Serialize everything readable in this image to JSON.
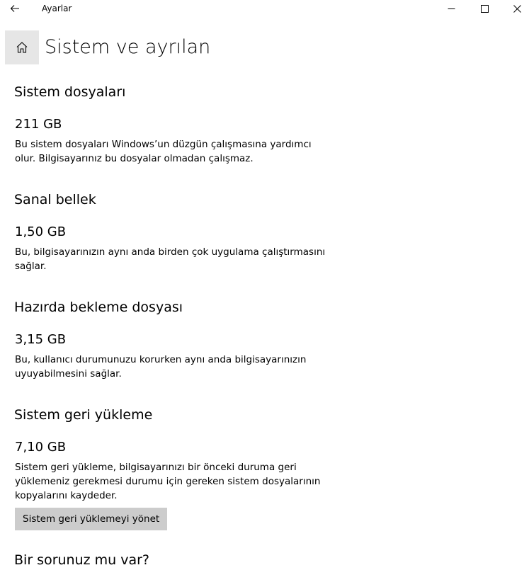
{
  "window": {
    "app_title": "Ayarlar",
    "back_icon": "back-arrow-icon",
    "minimize_icon": "minimize-icon",
    "maximize_icon": "maximize-icon",
    "close_icon": "close-icon"
  },
  "header": {
    "home_icon": "home-icon",
    "page_title": "Sistem ve ayrılan"
  },
  "sections": [
    {
      "title": "Sistem dosyaları",
      "size": "211 GB",
      "description": "Bu sistem dosyaları Windows’un düzgün çalışmasına yardımcı olur. Bilgisayarınız bu dosyalar olmadan çalışmaz."
    },
    {
      "title": "Sanal bellek",
      "size": "1,50 GB",
      "description": "Bu, bilgisayarınızın aynı anda birden çok uygulama çalıştırmasını sağlar."
    },
    {
      "title": "Hazırda bekleme dosyası",
      "size": "3,15 GB",
      "description": "Bu, kullanıcı durumunuzu korurken aynı anda bilgisayarınızın uyuyabilmesini sağlar."
    },
    {
      "title": "Sistem geri yükleme",
      "size": "7,10 GB",
      "description": "Sistem geri yükleme, bilgisayarınızı bir önceki duruma geri yüklemeniz gerekmesi durumu için gereken sistem dosyalarının kopyalarını kaydeder.",
      "button_label": "Sistem geri yüklemeyi yönet"
    }
  ],
  "help": {
    "title": "Bir sorunuz mu var?"
  }
}
